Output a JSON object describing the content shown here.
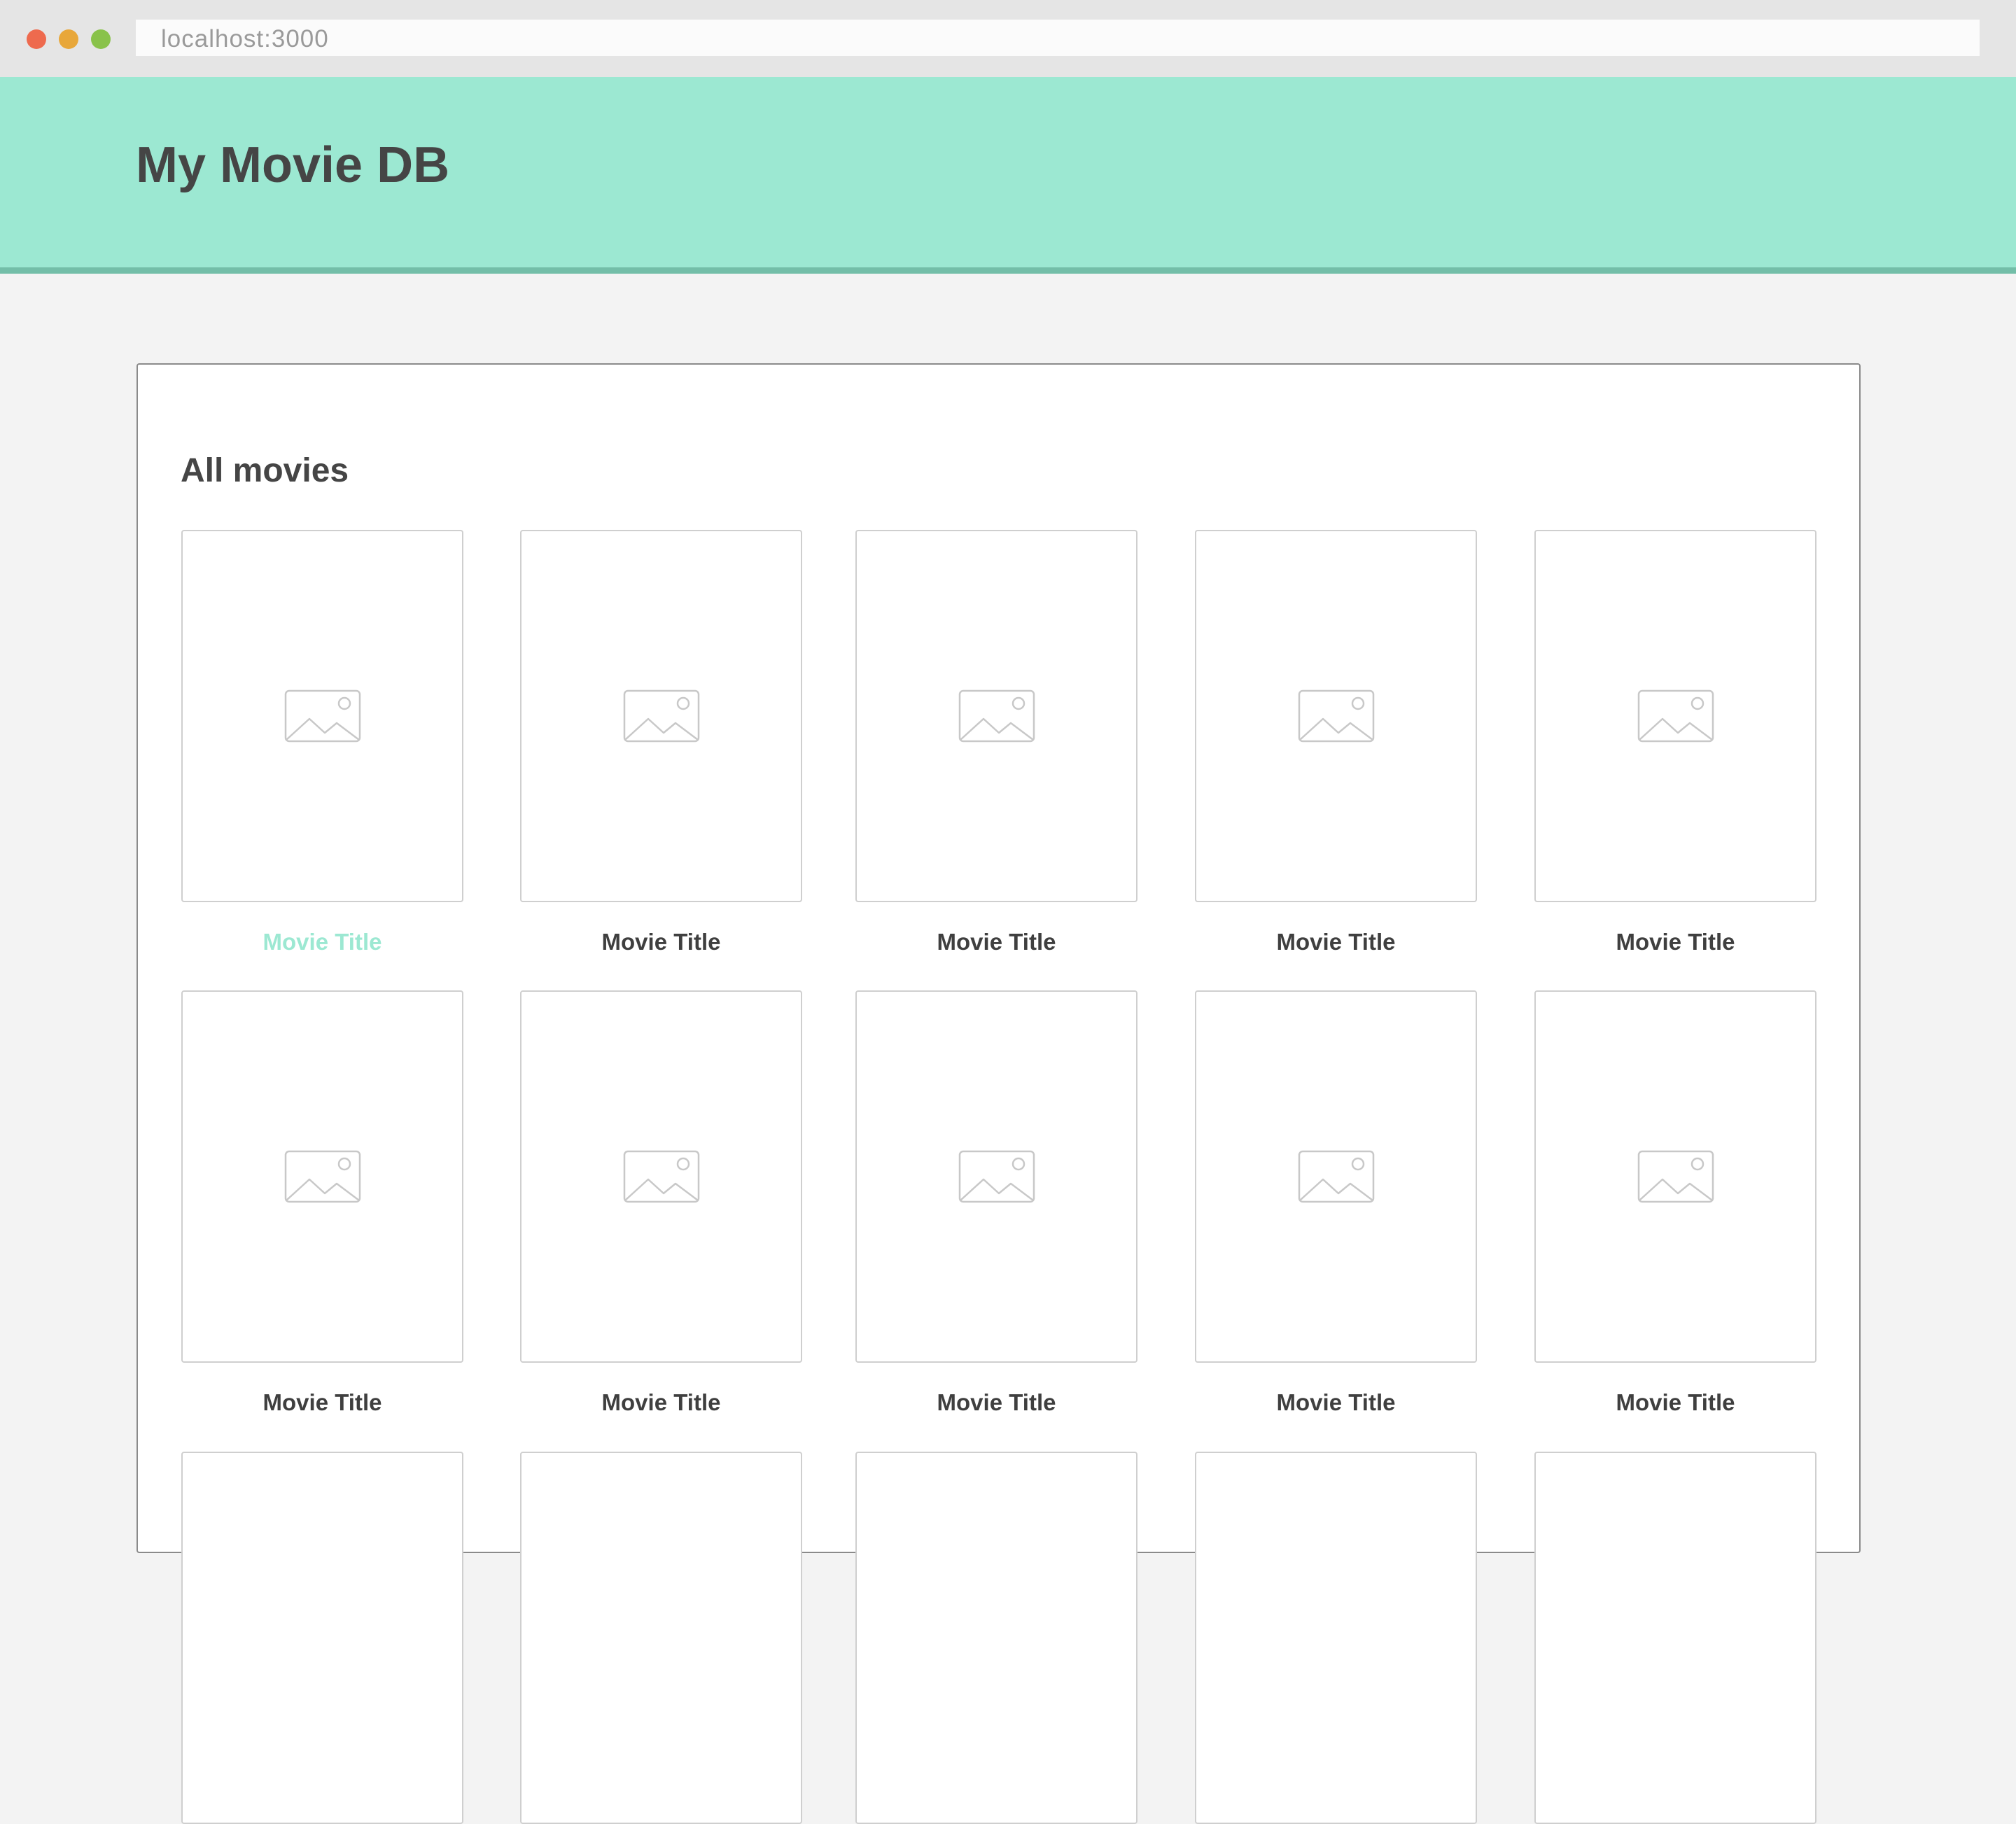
{
  "browser": {
    "url": "localhost:3000"
  },
  "header": {
    "title": "My Movie DB"
  },
  "main": {
    "section_title": "All movies",
    "movies": [
      {
        "title": "Movie Title",
        "active": true
      },
      {
        "title": "Movie Title"
      },
      {
        "title": "Movie Title"
      },
      {
        "title": "Movie Title"
      },
      {
        "title": "Movie Title"
      },
      {
        "title": "Movie Title"
      },
      {
        "title": "Movie Title"
      },
      {
        "title": "Movie Title"
      },
      {
        "title": "Movie Title"
      },
      {
        "title": "Movie Title"
      }
    ]
  },
  "colors": {
    "header_background": "#9ce8d2",
    "header_border": "#73bea8",
    "active_title": "#9ce8d2",
    "text_dark": "#454545"
  }
}
